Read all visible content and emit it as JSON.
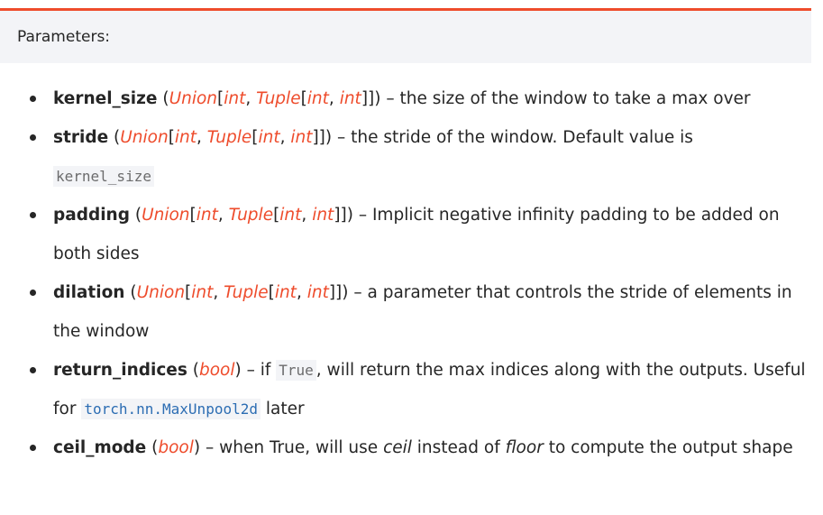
{
  "header": {
    "title": "Parameters:"
  },
  "params": [
    {
      "name": "kernel_size",
      "type_html": "(<span class=\"ptype\">Union</span>[<span class=\"ptype\">int</span>, <span class=\"ptype\">Tuple</span>[<span class=\"ptype\">int</span>, <span class=\"ptype\">int</span>]])",
      "desc": " – the size of the window to take a max over"
    },
    {
      "name": "stride",
      "desc": " – the stride of the window. Default value is",
      "code": "kernel_size"
    },
    {
      "name": "padding",
      "desc": " – Implicit negative infinity padding to be added on both sides"
    },
    {
      "name": "dilation",
      "desc": " – a parameter that controls the stride of elements in the window"
    },
    {
      "name": "return_indices",
      "type": "bool",
      "desc_a": " – if ",
      "code_a": "True",
      "desc_b": ", will return the max indices along with the outputs. Useful for ",
      "code_b": "torch.nn.MaxUnpool2d",
      "desc_c": " later"
    },
    {
      "name": "ceil_mode",
      "type": "bool",
      "desc_a": " – when True, will use ",
      "em_a": "ceil",
      "desc_b": " instead of ",
      "em_b": "floor",
      "desc_c": " to compute the output shape"
    }
  ],
  "type_union": {
    "union": "Union",
    "int": "int",
    "tuple": "Tuple"
  }
}
